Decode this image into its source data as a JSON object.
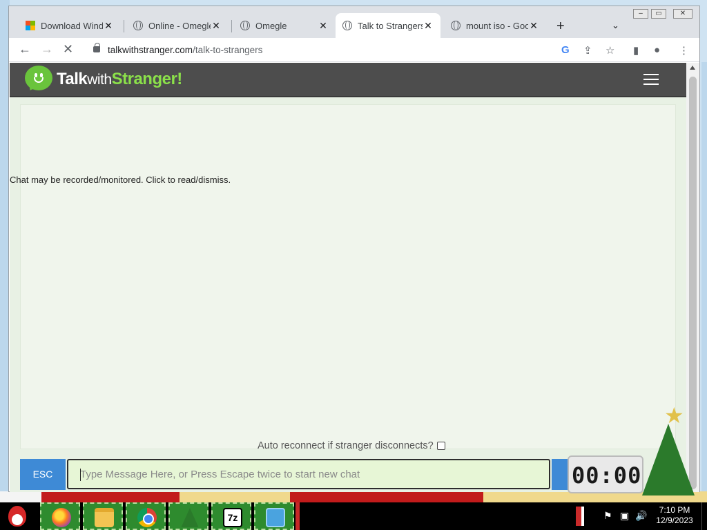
{
  "browser": {
    "tabs": [
      {
        "label": "Download Windows",
        "icon": "windows-logo-icon"
      },
      {
        "label": "Online - Omegle",
        "icon": "globe-icon"
      },
      {
        "label": "Omegle",
        "icon": "globe-icon"
      },
      {
        "label": "Talk to Strangers",
        "icon": "globe-icon",
        "active": true
      },
      {
        "label": "mount iso - Google",
        "icon": "globe-icon"
      }
    ],
    "new_tab_glyph": "+",
    "url_domain": "talkwithstranger.com",
    "url_path": "/talk-to-strangers"
  },
  "site": {
    "logo_part1": "Talk",
    "logo_part2": "with",
    "logo_part3": "Stranger!",
    "notice": "Chat may be recorded/monitored. Click to read/dismiss.",
    "reconnect_label": "Auto reconnect if stranger disconnects?",
    "reconnect_checked": false,
    "esc_label": "ESC",
    "message_placeholder": "Type Message Here, or Press Escape twice to start new chat",
    "message_value": ""
  },
  "gadget": {
    "clock_digits": "00:00"
  },
  "taskbar": {
    "apps": [
      "firefox-icon",
      "file-explorer-icon",
      "chrome-icon",
      "xmas-tree-icon",
      "7zip-icon",
      "network-icon"
    ],
    "sevenzip_label": "7z",
    "time": "7:10 PM",
    "date": "12/9/2023"
  },
  "colors": {
    "header_bg": "#4d4d4d",
    "accent_green": "#8be04a",
    "button_blue": "#3e8ad6",
    "input_bg": "#e7f6d6"
  }
}
